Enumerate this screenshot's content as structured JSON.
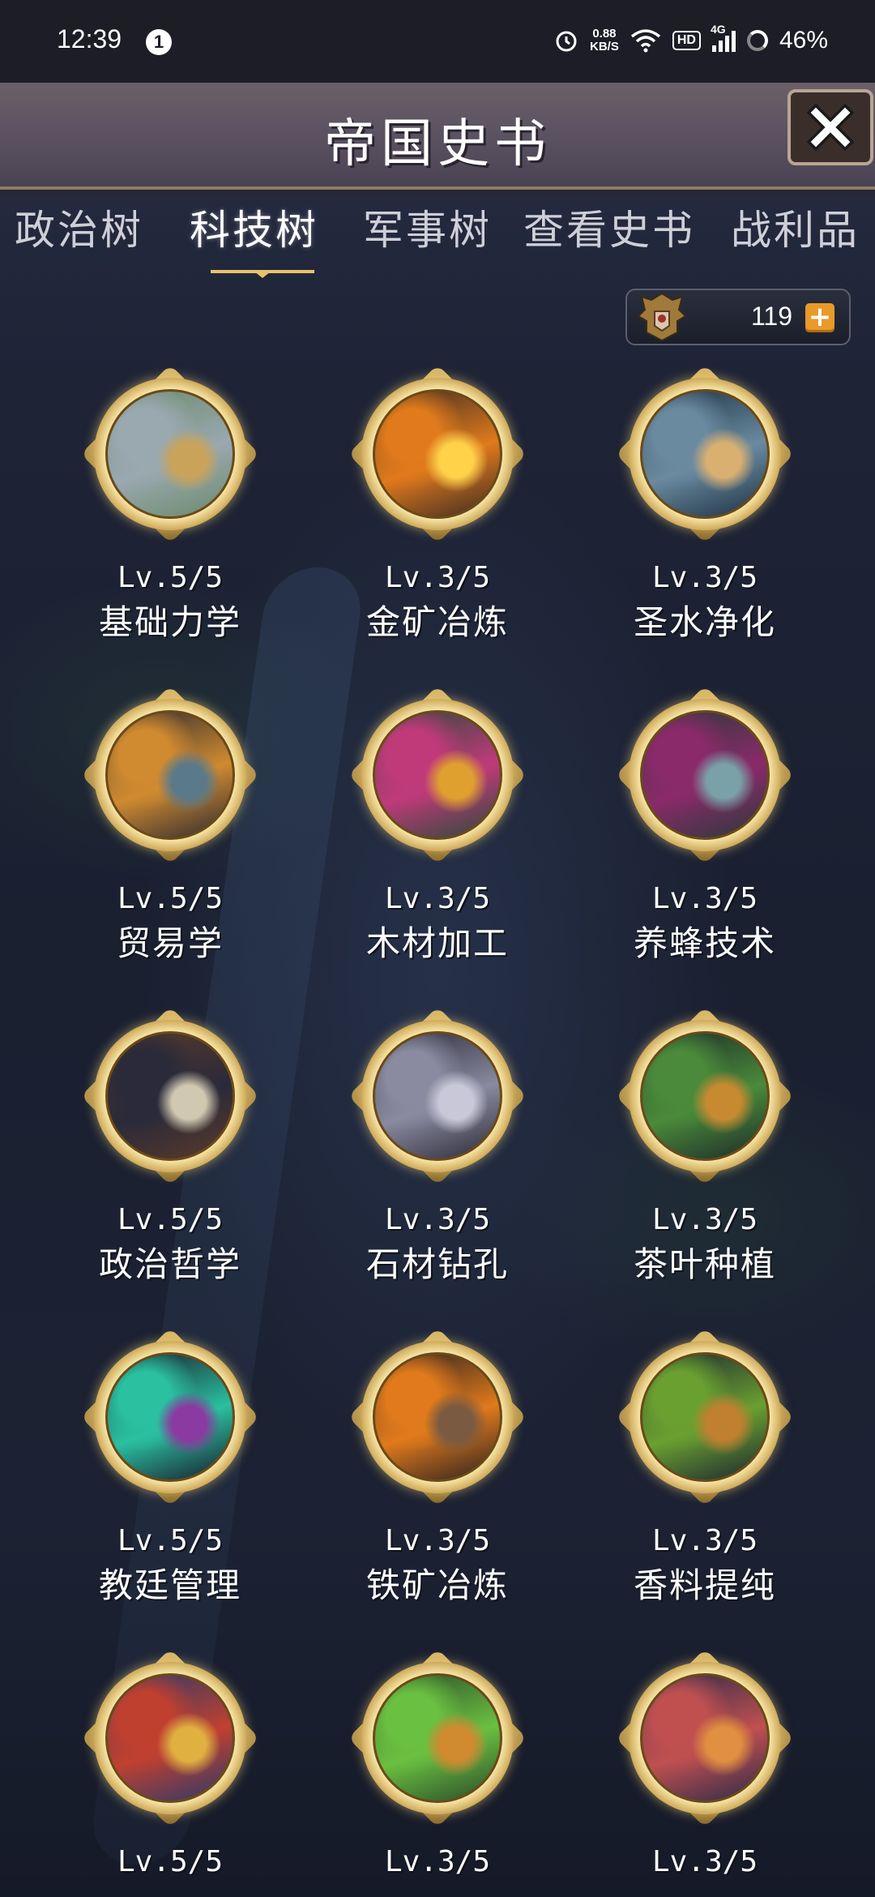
{
  "status_bar": {
    "time": "12:39",
    "notification_count": "1",
    "network_speed_value": "0.88",
    "network_speed_unit": "KB/S",
    "hd_label": "HD",
    "network_type": "4G",
    "battery": "46%"
  },
  "header": {
    "title": "帝国史书",
    "close_icon": "close-x-icon"
  },
  "tabs": [
    {
      "label": "政治树",
      "active": false
    },
    {
      "label": "科技树",
      "active": true
    },
    {
      "label": "军事树",
      "active": false
    },
    {
      "label": "查看史书",
      "active": false
    },
    {
      "label": "战利品",
      "active": false
    }
  ],
  "currency": {
    "value": "119",
    "emblem_icon": "eagle-crest-icon",
    "add_icon": "plus-icon",
    "add_label": "+"
  },
  "techs": [
    {
      "level": "Lv.5/5",
      "name": "基础力学",
      "scene": [
        "#6a8a6a",
        "#9aa8b0",
        "#c9a35a"
      ]
    },
    {
      "level": "Lv.3/5",
      "name": "金矿冶炼",
      "scene": [
        "#3b2a22",
        "#e07a1c",
        "#ffd24a"
      ]
    },
    {
      "level": "Lv.3/5",
      "name": "圣水净化",
      "scene": [
        "#1d3142",
        "#6a8aa0",
        "#d9b070"
      ]
    },
    {
      "level": "Lv.5/5",
      "name": "贸易学",
      "scene": [
        "#2c2a30",
        "#d08a30",
        "#5a7a8a"
      ]
    },
    {
      "level": "Lv.3/5",
      "name": "木材加工",
      "scene": [
        "#2a4a3a",
        "#c03a7a",
        "#e0a030"
      ]
    },
    {
      "level": "Lv.3/5",
      "name": "养蜂技术",
      "scene": [
        "#2a3a3a",
        "#8a2a6a",
        "#7aa0a8"
      ]
    },
    {
      "level": "Lv.5/5",
      "name": "政治哲学",
      "scene": [
        "#5a3a2a",
        "#2a2a3a",
        "#d0c8b0"
      ]
    },
    {
      "level": "Lv.3/5",
      "name": "石材钻孔",
      "scene": [
        "#2a2a36",
        "#8a8aa0",
        "#c8c8d8"
      ]
    },
    {
      "level": "Lv.3/5",
      "name": "茶叶种植",
      "scene": [
        "#1d2a2a",
        "#4a8a3a",
        "#c88a30"
      ]
    },
    {
      "level": "Lv.5/5",
      "name": "教廷管理",
      "scene": [
        "#1a1a2a",
        "#2ac0a0",
        "#8a3aa0"
      ]
    },
    {
      "level": "Lv.3/5",
      "name": "铁矿冶炼",
      "scene": [
        "#2a2020",
        "#e07a1c",
        "#7a5a40"
      ]
    },
    {
      "level": "Lv.3/5",
      "name": "香料提纯",
      "scene": [
        "#1a2430",
        "#6aa030",
        "#c08030"
      ]
    },
    {
      "level": "Lv.5/5",
      "name": "",
      "scene": [
        "#2a3a6a",
        "#c04030",
        "#e0b040"
      ]
    },
    {
      "level": "Lv.3/5",
      "name": "",
      "scene": [
        "#2a4a2a",
        "#6ac040",
        "#d08a30"
      ]
    },
    {
      "level": "Lv.3/5",
      "name": "",
      "scene": [
        "#2a2a4a",
        "#c05050",
        "#e09040"
      ]
    }
  ],
  "colors": {
    "accent_gold": "#e8c36a",
    "currency_plus": "#e89a2a",
    "text_white": "#ffffff"
  }
}
